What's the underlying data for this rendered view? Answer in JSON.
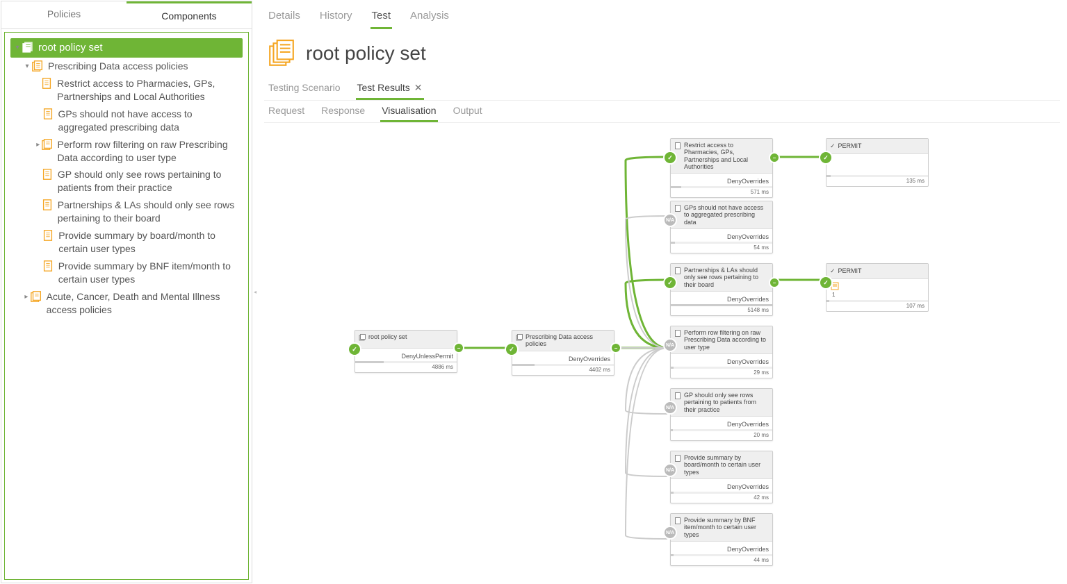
{
  "leftTabs": {
    "policies": "Policies",
    "components": "Components"
  },
  "tree": {
    "root": "root policy set",
    "group1": "Prescribing Data access policies",
    "items": [
      "Restrict access to Pharmacies, GPs, Partnerships and Local Authorities",
      "GPs should not have access to aggregated prescribing data",
      "Perform row filtering on raw Prescribing Data according to user type",
      "GP should only see rows pertaining to patients from their practice",
      "Partnerships & LAs should only see rows pertaining to their board",
      "Provide summary by board/month to certain user types",
      "Provide summary by BNF item/month to certain user types"
    ],
    "group2": "Acute, Cancer, Death and Mental Illness access policies"
  },
  "topTabs": {
    "details": "Details",
    "history": "History",
    "test": "Test",
    "analysis": "Analysis"
  },
  "title": "root policy set",
  "subTabs": {
    "scenario": "Testing Scenario",
    "results": "Test Results"
  },
  "subSubTabs": {
    "request": "Request",
    "response": "Response",
    "visualisation": "Visualisation",
    "output": "Output"
  },
  "nodes": {
    "root": {
      "title": "root policy set",
      "algo": "DenyUnlessPermit",
      "time": "4886 ms",
      "fill": "28%"
    },
    "policies": {
      "title": "Prescribing Data access policies",
      "algo": "DenyOverrides",
      "time": "4402 ms",
      "fill": "22%"
    },
    "restrict": {
      "title": "Restrict access to Pharmacies, GPs, Partnerships and Local Authorities",
      "algo": "DenyOverrides",
      "time": "571 ms",
      "fill": "10%"
    },
    "gpagg": {
      "title": "GPs should not have access to aggregated prescribing data",
      "algo": "DenyOverrides",
      "time": "54 ms",
      "fill": "4%"
    },
    "partla": {
      "title": "Partnerships & LAs should only see rows pertaining to their board",
      "algo": "DenyOverrides",
      "time": "5148 ms",
      "fill": "100%"
    },
    "rowfilter": {
      "title": "Perform row filtering on raw Prescribing Data according to user type",
      "algo": "DenyOverrides",
      "time": "29 ms",
      "fill": "3%"
    },
    "gppatients": {
      "title": "GP should only see rows pertaining to patients from their practice",
      "algo": "DenyOverrides",
      "time": "20 ms",
      "fill": "2%"
    },
    "boardmonth": {
      "title": "Provide summary by board/month to certain user types",
      "algo": "DenyOverrides",
      "time": "42 ms",
      "fill": "3%"
    },
    "bnfmonth": {
      "title": "Provide summary by BNF item/month to certain user types",
      "algo": "DenyOverrides",
      "time": "44 ms",
      "fill": "3%"
    }
  },
  "permit1": {
    "label": "PERMIT",
    "time": "135 ms"
  },
  "permit2": {
    "label": "PERMIT",
    "count": "1",
    "time": "107 ms"
  }
}
